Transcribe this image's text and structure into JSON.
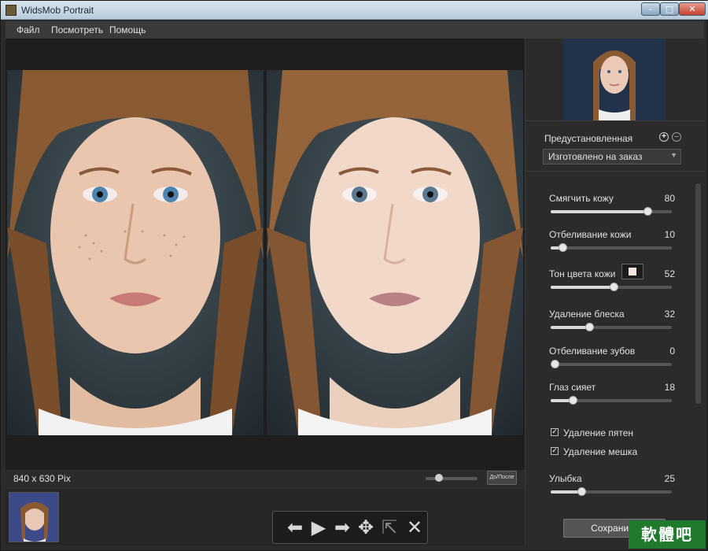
{
  "window": {
    "title": "WidsMob Portrait"
  },
  "menu": {
    "file": "Файл",
    "view": "Посмотреть",
    "help": "Помощь"
  },
  "canvas": {
    "dimensions": "840 x 630 Pix",
    "before_after_label": "До/После"
  },
  "panel": {
    "preset_label": "Предустановленная",
    "preset_value": "Изготовлено на заказ",
    "sliders": [
      {
        "label": "Смягчить кожу",
        "value": "80",
        "level": 80
      },
      {
        "label": "Отбеливание кожи",
        "value": "10",
        "level": 10
      },
      {
        "label": "Тон цвета кожи",
        "value": "52",
        "level": 52
      },
      {
        "label": "Удаление блеска",
        "value": "32",
        "level": 32
      },
      {
        "label": "Отбеливание зубов",
        "value": "0",
        "level": 0
      },
      {
        "label": "Глаз сияет",
        "value": "18",
        "level": 18
      },
      {
        "label": "Улыбка",
        "value": "25",
        "level": 25
      }
    ],
    "checkboxes": [
      {
        "label": "Удаление пятен",
        "checked": true
      },
      {
        "label": "Удаление мешка",
        "checked": true
      }
    ],
    "save_label": "Сохранить"
  },
  "watermark": "軟體吧"
}
